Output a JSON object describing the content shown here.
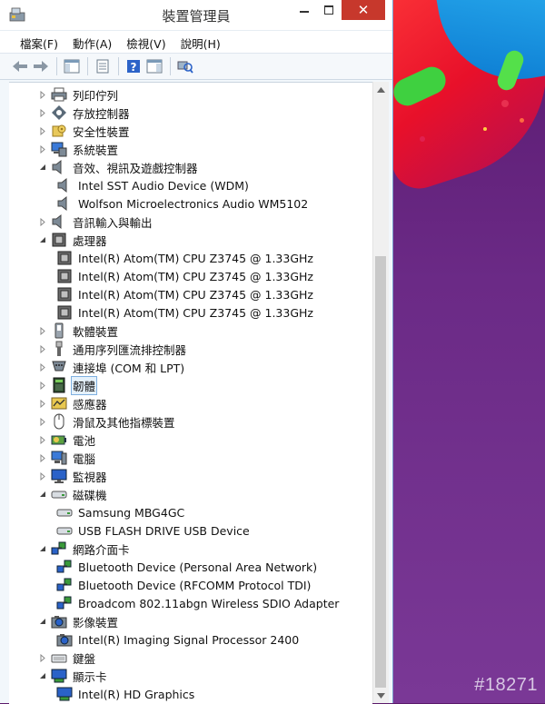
{
  "window": {
    "title": "裝置管理員",
    "close_glyph": "✕"
  },
  "menu": [
    "檔案(F)",
    "動作(A)",
    "檢視(V)",
    "說明(H)"
  ],
  "toolbar_icons": [
    "back-arrow-icon",
    "forward-arrow-icon",
    "show-hide-tree-icon",
    "properties-icon",
    "help-icon",
    "action-pane-icon",
    "scan-hardware-icon"
  ],
  "tree": [
    {
      "label": "列印佇列",
      "level": 0,
      "state": "collapsed",
      "icon": "printer-icon"
    },
    {
      "label": "存放控制器",
      "level": 0,
      "state": "collapsed",
      "icon": "storage-controller-icon"
    },
    {
      "label": "安全性裝置",
      "level": 0,
      "state": "collapsed",
      "icon": "security-device-icon"
    },
    {
      "label": "系統裝置",
      "level": 0,
      "state": "collapsed",
      "icon": "system-device-icon"
    },
    {
      "label": "音效、視訊及遊戲控制器",
      "level": 0,
      "state": "expanded",
      "icon": "speaker-icon"
    },
    {
      "label": "Intel SST Audio Device (WDM)",
      "level": 1,
      "state": "none",
      "icon": "speaker-icon"
    },
    {
      "label": "Wolfson Microelectronics Audio WM5102",
      "level": 1,
      "state": "none",
      "icon": "speaker-icon"
    },
    {
      "label": "音訊輸入與輸出",
      "level": 0,
      "state": "collapsed",
      "icon": "speaker-icon"
    },
    {
      "label": "處理器",
      "level": 0,
      "state": "expanded",
      "icon": "processor-icon"
    },
    {
      "label": "Intel(R) Atom(TM) CPU  Z3745  @ 1.33GHz",
      "level": 1,
      "state": "none",
      "icon": "processor-icon"
    },
    {
      "label": "Intel(R) Atom(TM) CPU  Z3745  @ 1.33GHz",
      "level": 1,
      "state": "none",
      "icon": "processor-icon"
    },
    {
      "label": "Intel(R) Atom(TM) CPU  Z3745  @ 1.33GHz",
      "level": 1,
      "state": "none",
      "icon": "processor-icon"
    },
    {
      "label": "Intel(R) Atom(TM) CPU  Z3745  @ 1.33GHz",
      "level": 1,
      "state": "none",
      "icon": "processor-icon"
    },
    {
      "label": "軟體裝置",
      "level": 0,
      "state": "collapsed",
      "icon": "software-device-icon"
    },
    {
      "label": "通用序列匯流排控制器",
      "level": 0,
      "state": "collapsed",
      "icon": "usb-icon"
    },
    {
      "label": "連接埠 (COM 和 LPT)",
      "level": 0,
      "state": "collapsed",
      "icon": "port-icon"
    },
    {
      "label": "韌體",
      "level": 0,
      "state": "collapsed",
      "icon": "firmware-icon",
      "selected": true
    },
    {
      "label": "感應器",
      "level": 0,
      "state": "collapsed",
      "icon": "sensor-icon"
    },
    {
      "label": "滑鼠及其他指標裝置",
      "level": 0,
      "state": "collapsed",
      "icon": "mouse-icon"
    },
    {
      "label": "電池",
      "level": 0,
      "state": "collapsed",
      "icon": "battery-icon"
    },
    {
      "label": "電腦",
      "level": 0,
      "state": "collapsed",
      "icon": "computer-icon"
    },
    {
      "label": "監視器",
      "level": 0,
      "state": "collapsed",
      "icon": "monitor-icon"
    },
    {
      "label": "磁碟機",
      "level": 0,
      "state": "expanded",
      "icon": "disk-drive-icon"
    },
    {
      "label": "Samsung MBG4GC",
      "level": 1,
      "state": "none",
      "icon": "disk-drive-icon"
    },
    {
      "label": "USB FLASH DRIVE USB Device",
      "level": 1,
      "state": "none",
      "icon": "disk-drive-icon"
    },
    {
      "label": "網路介面卡",
      "level": 0,
      "state": "expanded",
      "icon": "network-adapter-icon"
    },
    {
      "label": "Bluetooth Device (Personal Area Network)",
      "level": 1,
      "state": "none",
      "icon": "network-adapter-icon"
    },
    {
      "label": "Bluetooth Device (RFCOMM Protocol TDI)",
      "level": 1,
      "state": "none",
      "icon": "network-adapter-icon"
    },
    {
      "label": "Broadcom 802.11abgn Wireless SDIO Adapter",
      "level": 1,
      "state": "none",
      "icon": "network-adapter-icon"
    },
    {
      "label": "影像裝置",
      "level": 0,
      "state": "expanded",
      "icon": "camera-icon"
    },
    {
      "label": "Intel(R) Imaging Signal Processor 2400",
      "level": 1,
      "state": "none",
      "icon": "camera-icon"
    },
    {
      "label": "鍵盤",
      "level": 0,
      "state": "collapsed",
      "icon": "keyboard-icon"
    },
    {
      "label": "顯示卡",
      "level": 0,
      "state": "expanded",
      "icon": "display-adapter-icon"
    },
    {
      "label": "Intel(R) HD Graphics",
      "level": 1,
      "state": "none",
      "icon": "display-adapter-icon"
    }
  ],
  "watermark": "#18271"
}
